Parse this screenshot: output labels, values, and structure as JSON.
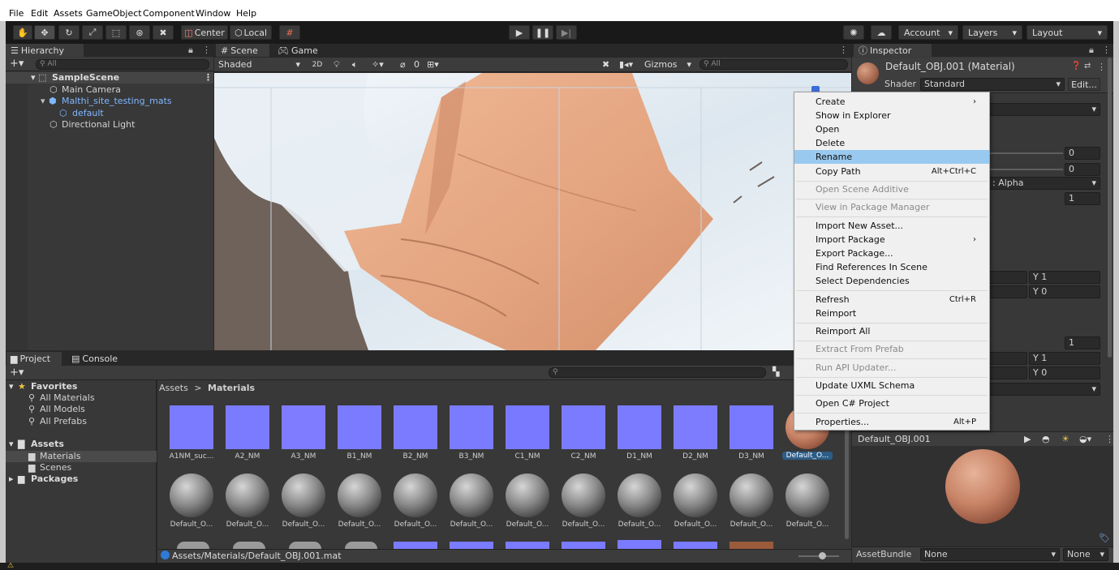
{
  "menubar": [
    "File",
    "Edit",
    "Assets",
    "GameObject",
    "Component",
    "Window",
    "Help"
  ],
  "toolbar": {
    "center_label": "Center",
    "local_label": "Local",
    "account_label": "Account",
    "layers_label": "Layers",
    "layout_label": "Layout"
  },
  "hierarchy": {
    "tab": "Hierarchy",
    "search_placeholder": "All",
    "items": [
      {
        "label": "SampleScene"
      },
      {
        "label": "Main Camera"
      },
      {
        "label": "Malthi_site_testing_mats"
      },
      {
        "label": "default"
      },
      {
        "label": "Directional Light"
      }
    ]
  },
  "scene": {
    "tab_scene": "Scene",
    "tab_game": "Game",
    "shading": "Shaded",
    "mode_2d": "2D",
    "hidden_count": "0",
    "gizmos": "Gizmos",
    "search_placeholder": "All"
  },
  "inspector": {
    "tab": "Inspector",
    "title": "Default_OBJ.001 (Material)",
    "shader_label": "Shader",
    "shader_value": "Standard",
    "edit_label": "Edit...",
    "frag_alpha": ": Alpha",
    "v0a": "0",
    "v0b": "0",
    "v1": "1",
    "y1a": "Y 1",
    "y0a": "Y 0",
    "v1b": "1",
    "y1b": "Y 1",
    "y0b": "Y 0",
    "preview_title": "Default_OBJ.001",
    "assetbundle_label": "AssetBundle",
    "assetbundle_value": "None",
    "assetbundle_variant": "None"
  },
  "project": {
    "tab_project": "Project",
    "tab_console": "Console",
    "favorites_label": "Favorites",
    "favorites": [
      "All Materials",
      "All Models",
      "All Prefabs"
    ],
    "assets_label": "Assets",
    "asset_folders": [
      "Materials",
      "Scenes"
    ],
    "packages_label": "Packages",
    "breadcrumb_root": "Assets",
    "breadcrumb_sep": ">",
    "breadcrumb_leaf": "Materials",
    "row1": [
      "A1NM_suc...",
      "A2_NM",
      "A3_NM",
      "B1_NM",
      "B2_NM",
      "B3_NM",
      "C1_NM",
      "C2_NM",
      "D1_NM",
      "D2_NM",
      "D3_NM",
      "Default_O..."
    ],
    "row2": [
      "Default_O...",
      "Default_O...",
      "Default_O...",
      "Default_O...",
      "Default_O...",
      "Default_O...",
      "Default_O...",
      "Default_O...",
      "Default_O...",
      "Default_O...",
      "Default_O...",
      "Default_O..."
    ],
    "status_path": "Assets/Materials/Default_OBJ.001.mat"
  },
  "context_menu": [
    {
      "label": "Create",
      "shortcut": "",
      "arrow": true,
      "disabled": false
    },
    {
      "label": "Show in Explorer",
      "shortcut": "",
      "arrow": false,
      "disabled": false
    },
    {
      "label": "Open",
      "shortcut": "",
      "arrow": false,
      "disabled": false
    },
    {
      "label": "Delete",
      "shortcut": "",
      "arrow": false,
      "disabled": false
    },
    {
      "label": "Rename",
      "shortcut": "",
      "arrow": false,
      "disabled": false,
      "highlighted": true
    },
    {
      "label": "Copy Path",
      "shortcut": "Alt+Ctrl+C",
      "arrow": false,
      "disabled": false
    },
    {
      "label": "Open Scene Additive",
      "shortcut": "",
      "arrow": false,
      "disabled": true
    },
    {
      "label": "View in Package Manager",
      "shortcut": "",
      "arrow": false,
      "disabled": true
    },
    {
      "label": "Import New Asset...",
      "shortcut": "",
      "arrow": false,
      "disabled": false
    },
    {
      "label": "Import Package",
      "shortcut": "",
      "arrow": true,
      "disabled": false
    },
    {
      "label": "Export Package...",
      "shortcut": "",
      "arrow": false,
      "disabled": false
    },
    {
      "label": "Find References In Scene",
      "shortcut": "",
      "arrow": false,
      "disabled": false
    },
    {
      "label": "Select Dependencies",
      "shortcut": "",
      "arrow": false,
      "disabled": false
    },
    {
      "label": "Refresh",
      "shortcut": "Ctrl+R",
      "arrow": false,
      "disabled": false
    },
    {
      "label": "Reimport",
      "shortcut": "",
      "arrow": false,
      "disabled": false
    },
    {
      "label": "Reimport All",
      "shortcut": "",
      "arrow": false,
      "disabled": false
    },
    {
      "label": "Extract From Prefab",
      "shortcut": "",
      "arrow": false,
      "disabled": true
    },
    {
      "label": "Run API Updater...",
      "shortcut": "",
      "arrow": false,
      "disabled": true
    },
    {
      "label": "Update UXML Schema",
      "shortcut": "",
      "arrow": false,
      "disabled": false
    },
    {
      "label": "Open C# Project",
      "shortcut": "",
      "arrow": false,
      "disabled": false
    },
    {
      "label": "Properties...",
      "shortcut": "Alt+P",
      "arrow": false,
      "disabled": false
    }
  ],
  "colors": {
    "editor_bg": "#383838",
    "panel_bg": "#282828",
    "selection": "#2c5d87",
    "menu_highlight": "#99c9ef",
    "normal_map": "#7b7bff",
    "sand": "#e5a987"
  }
}
